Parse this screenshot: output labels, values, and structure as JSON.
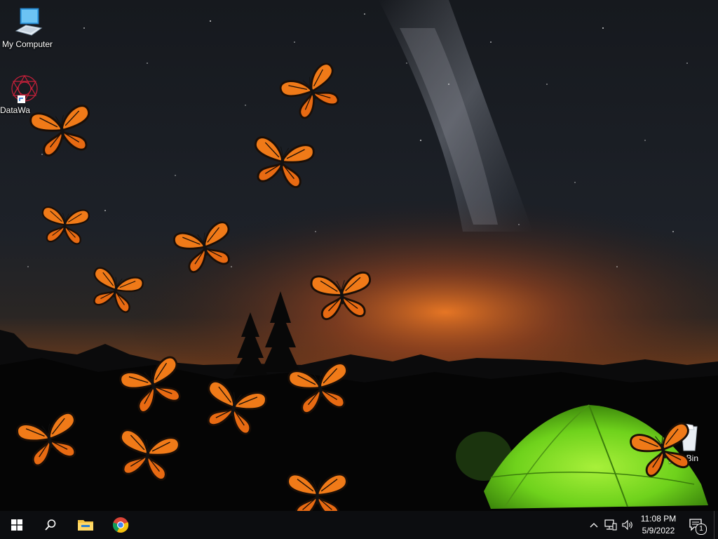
{
  "desktop": {
    "icons": [
      {
        "label": "My Computer",
        "icon": "my-computer-icon"
      },
      {
        "label": "DataWa",
        "icon": "datawa-shortcut-icon"
      },
      {
        "label": "ycle Bin",
        "icon": "recycle-bin-icon"
      }
    ],
    "wallpaper": "night-sky-milky-way-with-green-tent",
    "overlay": "orange-monarch-butterflies"
  },
  "taskbar": {
    "start": "windows-start-icon",
    "search": "search-icon",
    "pinned": [
      "file-explorer-icon",
      "chrome-icon"
    ],
    "tray": {
      "chevron": "show-hidden-icons-chevron",
      "network": "network-icon",
      "volume": "volume-icon",
      "time": "11:08 PM",
      "date": "5/9/2022",
      "notifications_count": "1"
    }
  },
  "colors": {
    "taskbar_bg": "#0c0d10",
    "butterfly_orange": "#f07a18",
    "tent_green": "#6fd21c",
    "horizon_glow": "#e8651c"
  }
}
